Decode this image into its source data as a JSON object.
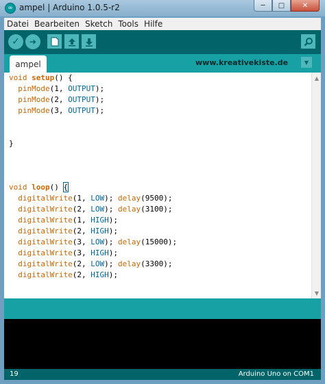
{
  "window": {
    "title": "ampel | Arduino 1.0.5-r2",
    "app_icon_glyph": "∞",
    "minimize_glyph": "─",
    "maximize_glyph": "□",
    "close_glyph": "✕"
  },
  "menu": [
    "Datei",
    "Bearbeiten",
    "Sketch",
    "Tools",
    "Hilfe"
  ],
  "toolbar": {
    "verify_glyph": "✓",
    "upload_glyph": "➜",
    "icons": [
      "verify-icon",
      "upload-icon",
      "new-icon",
      "open-icon",
      "save-icon",
      "serial-monitor-icon"
    ]
  },
  "tabs": {
    "active": "ampel",
    "site": "www.kreativekiste.de",
    "menu_glyph": "▼"
  },
  "code": [
    {
      "parts": [
        {
          "t": "void",
          "c": "kw-type"
        },
        {
          "t": " "
        },
        {
          "t": "setup",
          "c": "kw-fn"
        },
        {
          "t": "() {"
        }
      ]
    },
    {
      "parts": [
        {
          "t": "  "
        },
        {
          "t": "pinMode",
          "c": "kw-call"
        },
        {
          "t": "(1, "
        },
        {
          "t": "OUTPUT",
          "c": "kw-const"
        },
        {
          "t": ");"
        }
      ]
    },
    {
      "parts": [
        {
          "t": "  "
        },
        {
          "t": "pinMode",
          "c": "kw-call"
        },
        {
          "t": "(2, "
        },
        {
          "t": "OUTPUT",
          "c": "kw-const"
        },
        {
          "t": ");"
        }
      ]
    },
    {
      "parts": [
        {
          "t": "  "
        },
        {
          "t": "pinMode",
          "c": "kw-call"
        },
        {
          "t": "(3, "
        },
        {
          "t": "OUTPUT",
          "c": "kw-const"
        },
        {
          "t": ");"
        }
      ]
    },
    {
      "parts": [
        {
          "t": ""
        }
      ]
    },
    {
      "parts": [
        {
          "t": ""
        }
      ]
    },
    {
      "parts": [
        {
          "t": "}"
        }
      ]
    },
    {
      "parts": [
        {
          "t": ""
        }
      ]
    },
    {
      "parts": [
        {
          "t": ""
        }
      ]
    },
    {
      "parts": [
        {
          "t": ""
        }
      ]
    },
    {
      "parts": [
        {
          "t": "void",
          "c": "kw-type"
        },
        {
          "t": " "
        },
        {
          "t": "loop",
          "c": "kw-fn"
        },
        {
          "t": "() "
        },
        {
          "t": "{",
          "c": "brace-hl"
        }
      ]
    },
    {
      "parts": [
        {
          "t": "  "
        },
        {
          "t": "digitalWrite",
          "c": "kw-call"
        },
        {
          "t": "(1, "
        },
        {
          "t": "LOW",
          "c": "kw-const"
        },
        {
          "t": "); "
        },
        {
          "t": "delay",
          "c": "kw-call"
        },
        {
          "t": "(9500);"
        }
      ]
    },
    {
      "parts": [
        {
          "t": "  "
        },
        {
          "t": "digitalWrite",
          "c": "kw-call"
        },
        {
          "t": "(2, "
        },
        {
          "t": "LOW",
          "c": "kw-const"
        },
        {
          "t": "); "
        },
        {
          "t": "delay",
          "c": "kw-call"
        },
        {
          "t": "(3100);"
        }
      ]
    },
    {
      "parts": [
        {
          "t": "  "
        },
        {
          "t": "digitalWrite",
          "c": "kw-call"
        },
        {
          "t": "(1, "
        },
        {
          "t": "HIGH",
          "c": "kw-const"
        },
        {
          "t": ");"
        }
      ]
    },
    {
      "parts": [
        {
          "t": "  "
        },
        {
          "t": "digitalWrite",
          "c": "kw-call"
        },
        {
          "t": "(2, "
        },
        {
          "t": "HIGH",
          "c": "kw-const"
        },
        {
          "t": ");"
        }
      ]
    },
    {
      "parts": [
        {
          "t": "  "
        },
        {
          "t": "digitalWrite",
          "c": "kw-call"
        },
        {
          "t": "(3, "
        },
        {
          "t": "LOW",
          "c": "kw-const"
        },
        {
          "t": "); "
        },
        {
          "t": "delay",
          "c": "kw-call"
        },
        {
          "t": "(15000);"
        }
      ]
    },
    {
      "parts": [
        {
          "t": "  "
        },
        {
          "t": "digitalWrite",
          "c": "kw-call"
        },
        {
          "t": "(3, "
        },
        {
          "t": "HIGH",
          "c": "kw-const"
        },
        {
          "t": ");"
        }
      ]
    },
    {
      "parts": [
        {
          "t": "  "
        },
        {
          "t": "digitalWrite",
          "c": "kw-call"
        },
        {
          "t": "(2, "
        },
        {
          "t": "LOW",
          "c": "kw-const"
        },
        {
          "t": "); "
        },
        {
          "t": "delay",
          "c": "kw-call"
        },
        {
          "t": "(3300);"
        }
      ]
    },
    {
      "parts": [
        {
          "t": "  "
        },
        {
          "t": "digitalWrite",
          "c": "kw-call"
        },
        {
          "t": "(2, "
        },
        {
          "t": "HIGH",
          "c": "kw-const"
        },
        {
          "t": ");"
        }
      ]
    },
    {
      "parts": [
        {
          "t": ""
        }
      ]
    },
    {
      "parts": [
        {
          "t": ""
        }
      ]
    },
    {
      "parts": [
        {
          "t": "}"
        }
      ]
    }
  ],
  "status": {
    "line": "19",
    "board": "Arduino Uno on COM1"
  },
  "colors": {
    "frame": "#006468",
    "accent": "#17a1a5",
    "button": "#4db7bb",
    "keyword": "#cc6600",
    "constant": "#006699"
  }
}
